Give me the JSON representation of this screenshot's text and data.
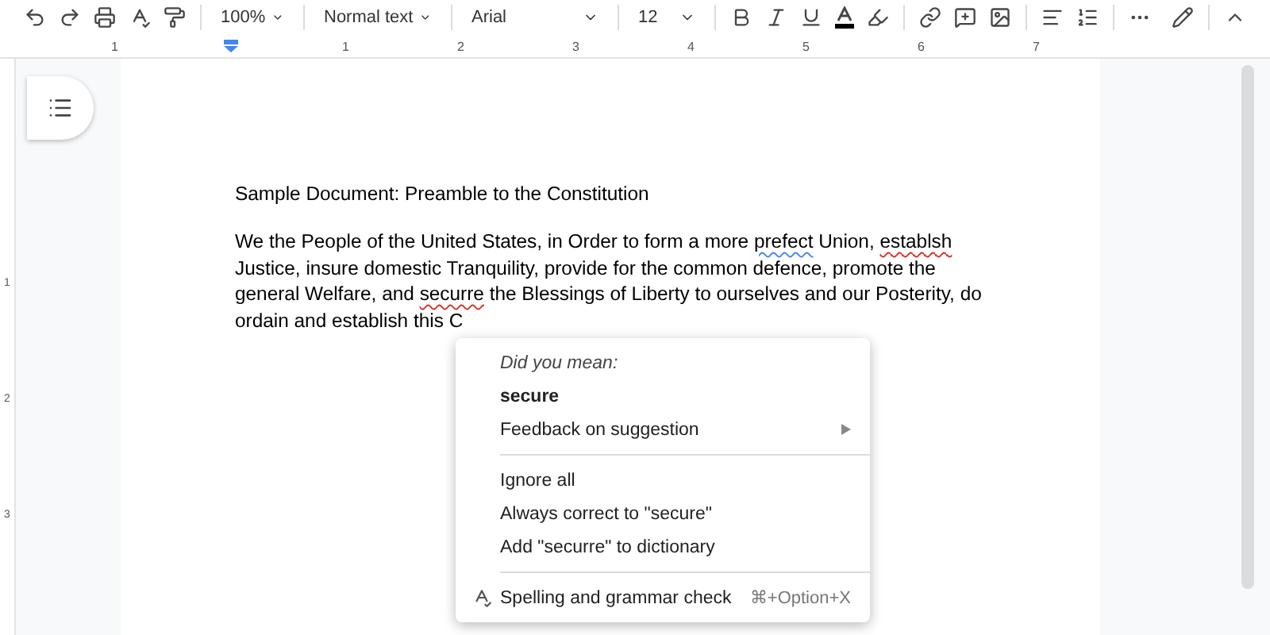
{
  "toolbar": {
    "zoom": "100%",
    "style": "Normal text",
    "font": "Arial",
    "size": "12"
  },
  "ruler": {
    "labels": [
      "1",
      "1",
      "2",
      "3",
      "4",
      "5",
      "6",
      "7"
    ]
  },
  "vertical_ruler": {
    "labels": [
      "1",
      "2",
      "3"
    ]
  },
  "document": {
    "title": "Sample Document: Preamble to the Constitution",
    "lines": [
      [
        {
          "text": "We the People of the United States, in Order to form a more ",
          "spelling_error": false,
          "grammar_error": false
        },
        {
          "text": "prefect",
          "spelling_error": false,
          "grammar_error": true
        },
        {
          "text": " Union, ",
          "spelling_error": false,
          "grammar_error": false
        },
        {
          "text": "establsh",
          "spelling_error": true,
          "grammar_error": false
        }
      ],
      [
        {
          "text": "Justice, insure domestic Tranquility, provide for the common defence, promote the",
          "spelling_error": false,
          "grammar_error": false
        }
      ],
      [
        {
          "text": "general Welfare, and ",
          "spelling_error": false,
          "grammar_error": false
        },
        {
          "text": "securre",
          "spelling_error": true,
          "grammar_error": false
        },
        {
          "text": " the Blessings of Liberty to ourselves and our Posterity, do",
          "spelling_error": false,
          "grammar_error": false
        }
      ],
      [
        {
          "text": "ordain and establish this C",
          "spelling_error": false,
          "grammar_error": false
        }
      ]
    ]
  },
  "context_menu": {
    "items": [
      {
        "kind": "heading",
        "label": "Did you mean:"
      },
      {
        "kind": "suggestion",
        "label": "secure"
      },
      {
        "kind": "submenu",
        "label": "Feedback on suggestion"
      },
      {
        "kind": "divider"
      },
      {
        "kind": "action",
        "label": "Ignore all"
      },
      {
        "kind": "action",
        "label": "Always correct to \"secure\""
      },
      {
        "kind": "action",
        "label": "Add \"securre\" to dictionary"
      },
      {
        "kind": "divider"
      },
      {
        "kind": "command",
        "label": "Spelling and grammar check",
        "shortcut": "⌘+Option+X"
      }
    ]
  }
}
